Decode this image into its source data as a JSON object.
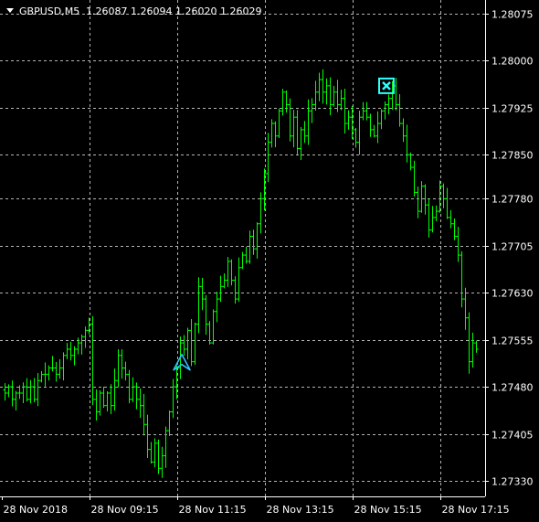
{
  "header": {
    "symbol_label": "GBPUSD,M5",
    "ohlc": "1.26087 1.26094 1.26020 1.26029"
  },
  "colors": {
    "background": "#000000",
    "grid": "#b4b4b4",
    "bars": "#00ff00",
    "arrow": "#2ec4ff",
    "close_marker": "#30ffff",
    "text": "#ffffff"
  },
  "chart_data": {
    "type": "bar",
    "title": "",
    "y_ticks": [
      "1.28075",
      "1.28000",
      "1.27925",
      "1.27850",
      "1.27780",
      "1.27705",
      "1.27630",
      "1.27555",
      "1.27480",
      "1.27405",
      "1.27330"
    ],
    "x_ticks": [
      "28 Nov 2018",
      "28 Nov 09:15",
      "28 Nov 11:15",
      "28 Nov 13:15",
      "28 Nov 15:15",
      "28 Nov 17:15"
    ],
    "ylim": [
      1.2732,
      1.2809
    ],
    "grid": true,
    "markers": [
      {
        "type": "buy-arrow",
        "time": "28 Nov 11:15",
        "price": 1.2752
      },
      {
        "type": "close-x",
        "time": "28 Nov 15:15",
        "price": 1.2796
      }
    ],
    "series": [
      {
        "close": [
          1.2747,
          1.2748,
          1.2746,
          1.2747,
          1.2747,
          1.2748,
          1.2746,
          1.2748,
          1.2746,
          1.2749,
          1.275,
          1.275,
          1.2751,
          1.2751,
          1.275,
          1.2751,
          1.2753,
          1.2754,
          1.2753,
          1.2754,
          1.2755,
          1.2756,
          1.2757,
          1.2758,
          1.2746,
          1.2744,
          1.2747,
          1.2745,
          1.2747,
          1.2745,
          1.2749,
          1.2753,
          1.2751,
          1.275,
          1.2746,
          1.2748,
          1.2746,
          1.2745,
          1.2742,
          1.2738,
          1.2736,
          1.2739,
          1.2735,
          1.2737,
          1.2741,
          1.2744,
          1.2748,
          1.2751,
          1.2755,
          1.2754,
          1.2757,
          1.2752,
          1.2758,
          1.2764,
          1.2762,
          1.2758,
          1.2755,
          1.276,
          1.2762,
          1.2764,
          1.2765,
          1.2768,
          1.2765,
          1.2762,
          1.2767,
          1.2769,
          1.2768,
          1.2772,
          1.277,
          1.2774,
          1.2778,
          1.2782,
          1.2787,
          1.279,
          1.2788,
          1.2792,
          1.2795,
          1.2793,
          1.2788,
          1.2791,
          1.2786,
          1.2789,
          1.2788,
          1.2792,
          1.2793,
          1.2795,
          1.2797,
          1.2795,
          1.2796,
          1.2793,
          1.2795,
          1.2793,
          1.2794,
          1.279,
          1.2791,
          1.2789,
          1.2787,
          1.2791,
          1.2792,
          1.2791,
          1.2789,
          1.2788,
          1.279,
          1.2792,
          1.2793,
          1.2794,
          1.2796,
          1.2793,
          1.279,
          1.2788,
          1.2785,
          1.2783,
          1.2779,
          1.2776,
          1.278,
          1.2777,
          1.2773,
          1.2775,
          1.2776,
          1.278,
          1.2778,
          1.2775,
          1.2774,
          1.2772,
          1.2769,
          1.2762,
          1.2759,
          1.2752,
          1.2755,
          1.2754
        ]
      }
    ]
  }
}
